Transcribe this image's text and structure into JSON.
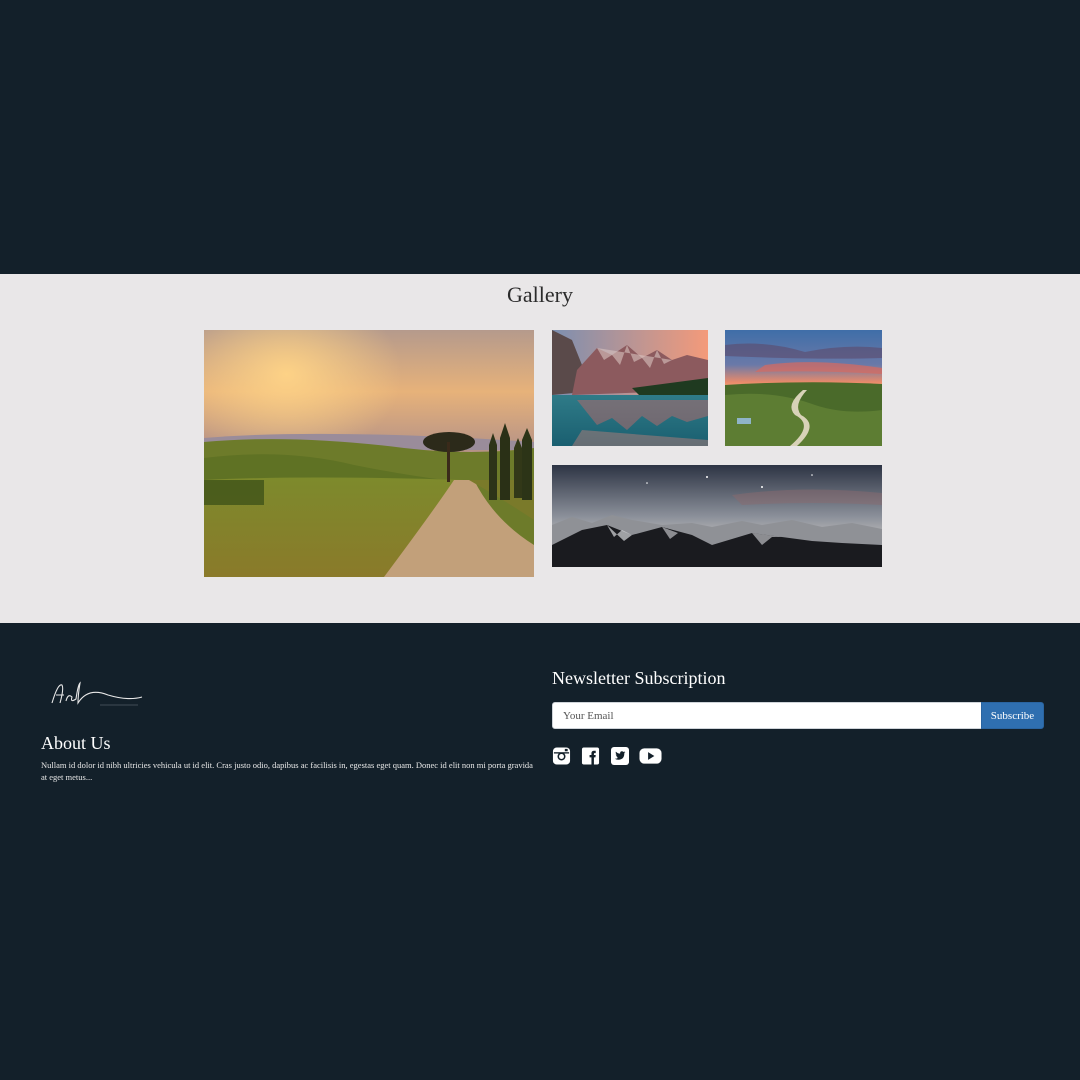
{
  "gallery": {
    "title": "Gallery",
    "images": [
      {
        "name": "tuscany-road-photo"
      },
      {
        "name": "mountain-lake-photo"
      },
      {
        "name": "valley-sunset-photo"
      },
      {
        "name": "mountain-night-photo"
      }
    ]
  },
  "footer": {
    "logo_name": "signature-logo",
    "about": {
      "title": "About Us",
      "text": "Nullam id dolor id nibh ultricies vehicula ut id elit. Cras justo odio, dapibus ac facilisis in, egestas eget quam. Donec id elit non mi porta gravida at eget metus..."
    },
    "newsletter": {
      "title": "Newsletter Subscription",
      "email_placeholder": "Your Email",
      "subscribe_label": "Subscribe"
    },
    "social_icons": [
      "instagram-icon",
      "facebook-icon",
      "twitter-icon",
      "youtube-icon"
    ]
  },
  "colors": {
    "background_dark": "#13202a",
    "gallery_background": "#e9e7e8",
    "button_blue": "#2f6fb0"
  }
}
